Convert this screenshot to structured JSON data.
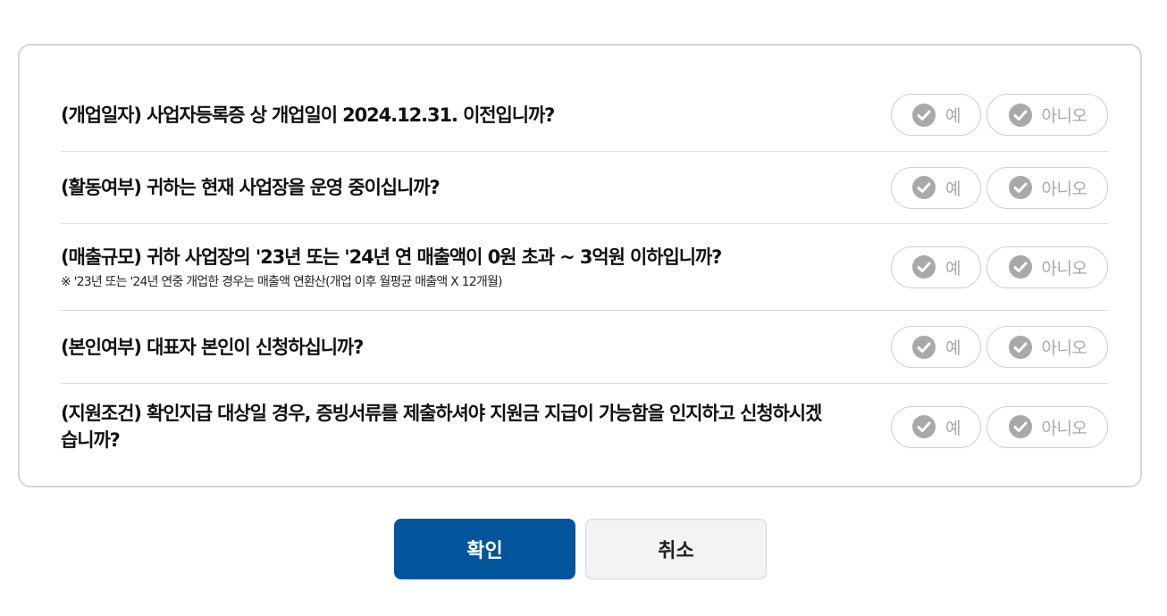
{
  "questions": [
    {
      "text": "(개업일자) 사업자등록증 상 개업일이 2024.12.31. 이전입니까?",
      "note": "",
      "yes_label": "예",
      "no_label": "아니오"
    },
    {
      "text": "(활동여부) 귀하는 현재 사업장을 운영 중이십니까?",
      "note": "",
      "yes_label": "예",
      "no_label": "아니오"
    },
    {
      "text": "(매출규모) 귀하 사업장의 '23년 또는 '24년 연 매출액이 0원 초과 ~ 3억원 이하입니까?",
      "note": "※ '23년 또는 '24년 연중 개업한 경우는 매출액 연환산(개업 이후 월평균 매출액 X 12개월)",
      "yes_label": "예",
      "no_label": "아니오"
    },
    {
      "text": "(본인여부) 대표자 본인이 신청하십니까?",
      "note": "",
      "yes_label": "예",
      "no_label": "아니오"
    },
    {
      "text": "(지원조건) 확인지급 대상일 경우, 증빙서류를 제출하셔야 지원금 지급이 가능함을 인지하고 신청하시겠습니까?",
      "note": "",
      "yes_label": "예",
      "no_label": "아니오"
    }
  ],
  "buttons": {
    "confirm_label": "확인",
    "cancel_label": "취소"
  },
  "icons": {
    "option_check": "check-circle-icon"
  },
  "colors": {
    "primary": "#00559b",
    "option_inactive": "#a9a9a9",
    "cancel_bg": "#f3f3f6"
  }
}
